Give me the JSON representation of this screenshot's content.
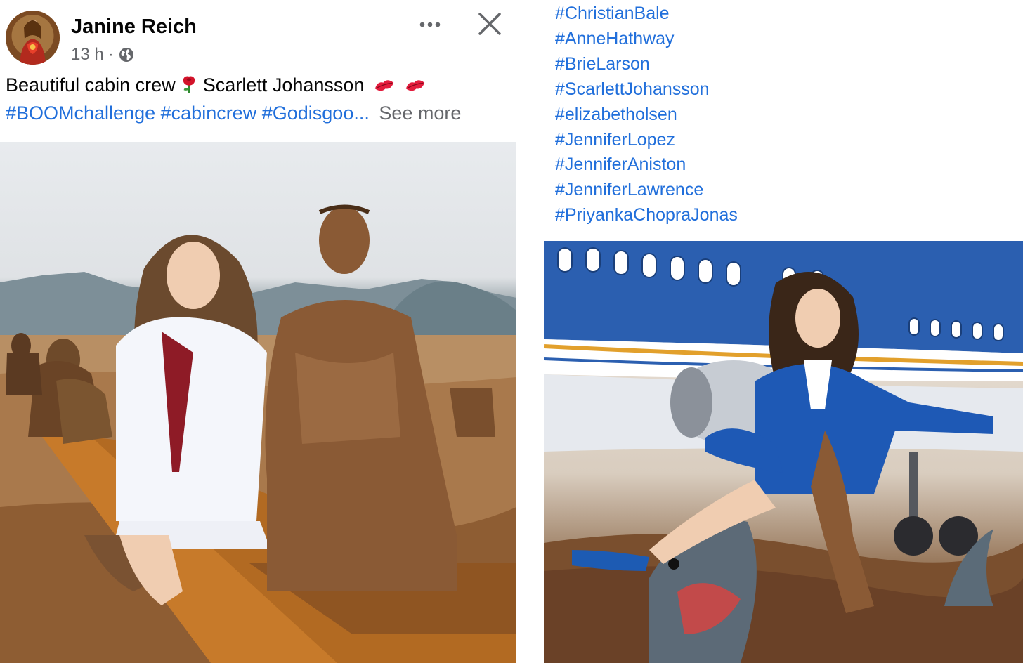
{
  "post": {
    "author": "Janine Reich",
    "time": "13 h",
    "separator": "·",
    "caption": "Beautiful cabin crew",
    "caption_name": "Scarlett Johansson",
    "tags": [
      "#BOOMchallenge",
      "#cabincrew",
      "#Godisgoo..."
    ],
    "see_more": "See more",
    "icons": {
      "avatar": "profile-avatar",
      "privacy": "globe-icon",
      "more": "more-options-icon",
      "close": "close-icon",
      "rose": "rose-emoji",
      "kiss": "kiss-mark-emoji"
    }
  },
  "hashtags": [
    "#ChristianBale",
    "#AnneHathway",
    "#BrieLarson",
    "#ScarlettJohansson",
    "#elizabetholsen",
    "#JenniferLopez",
    "#JenniferAniston",
    "#JenniferLawrence",
    "#PriyankaChopraJonas"
  ],
  "colors": {
    "link_blue": "#216fdb",
    "secondary_text": "#65676b",
    "primary_text": "#050505"
  }
}
